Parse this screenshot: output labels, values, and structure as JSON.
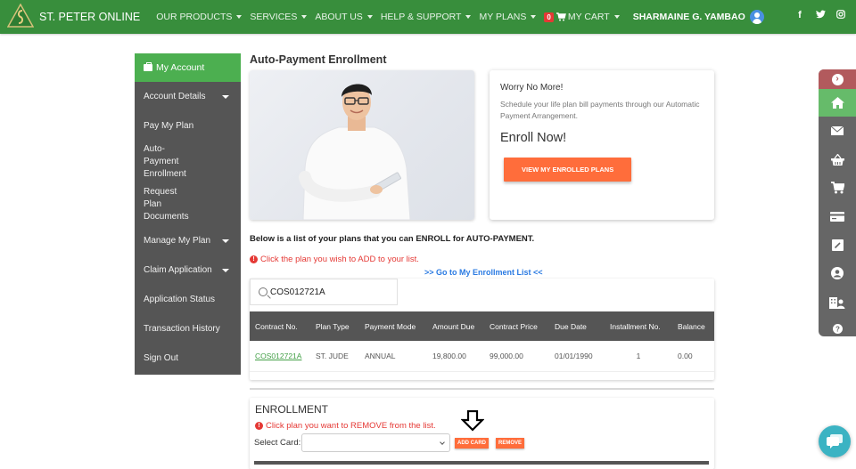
{
  "navbar": {
    "brand": "ST. PETER ONLINE",
    "menu": [
      {
        "label": "OUR PRODUCTS",
        "has_dropdown": true
      },
      {
        "label": "SERVICES",
        "has_dropdown": true
      },
      {
        "label": "ABOUT US",
        "has_dropdown": true
      },
      {
        "label": "HELP & SUPPORT",
        "has_dropdown": true
      },
      {
        "label": "MY PLANS",
        "has_dropdown": true
      }
    ],
    "cart": {
      "count": "0",
      "label": "MY CART"
    },
    "user_name": "SHARMAINE G. YAMBAO",
    "socials": [
      "facebook-icon",
      "twitter-icon",
      "instagram-icon"
    ],
    "colors": {
      "bar": "#388e3c",
      "badge": "#e53935",
      "avatar": "#4a90e2"
    }
  },
  "sidebar": {
    "header": "My Account",
    "items": [
      {
        "label": "Account Details",
        "has_dropdown": true
      },
      {
        "label": "Pay My Plan",
        "has_dropdown": false
      },
      {
        "label": "Auto-Payment Enrollment",
        "has_dropdown": false
      },
      {
        "label": "Request Plan Documents",
        "has_dropdown": false
      },
      {
        "label": "Manage My Plan",
        "has_dropdown": true
      },
      {
        "label": "Claim Application",
        "has_dropdown": true
      },
      {
        "label": "Application Status",
        "has_dropdown": false
      },
      {
        "label": "Transaction History",
        "has_dropdown": false
      },
      {
        "label": "Sign Out",
        "has_dropdown": false
      }
    ]
  },
  "main": {
    "title": "Auto-Payment Enrollment",
    "promo": {
      "heading": "Worry No More!",
      "text": "Schedule your life plan bill payments through our Automatic Payment Arrangement.",
      "big": "Enroll Now!",
      "button": "VIEW MY ENROLLED PLANS"
    },
    "list_intro": "Below is a list of your plans that you can ENROLL for AUTO-PAYMENT.",
    "add_hint": "Click the plan you wish to ADD to your list.",
    "enrollment_link": ">> Go to My Enrollment List <<",
    "search": {
      "value": "COS012721A",
      "placeholder": ""
    },
    "table": {
      "headers": [
        "Contract No.",
        "Plan Type",
        "Payment Mode",
        "Amount Due",
        "Contract Price",
        "Due Date",
        "Installment No.",
        "Balance"
      ],
      "rows": [
        [
          "COS012721A",
          "ST. JUDE",
          "ANNUAL",
          "19,800.00",
          "99,000.00",
          "01/01/1990",
          "1",
          "0.00"
        ]
      ]
    },
    "enrollment": {
      "title": "ENROLLMENT",
      "remove_hint": "Click plan you want to REMOVE from the list.",
      "select_label": "Select Card:",
      "select_value": "",
      "add_card": "ADD CARD",
      "remove": "REMOVE"
    }
  },
  "right_tools": [
    "chevron-right-icon",
    "home-icon",
    "envelope-icon",
    "basket-icon",
    "cart-icon",
    "credit-card-icon",
    "edit-icon",
    "user-circle-icon",
    "building-user-icon",
    "question-icon"
  ]
}
